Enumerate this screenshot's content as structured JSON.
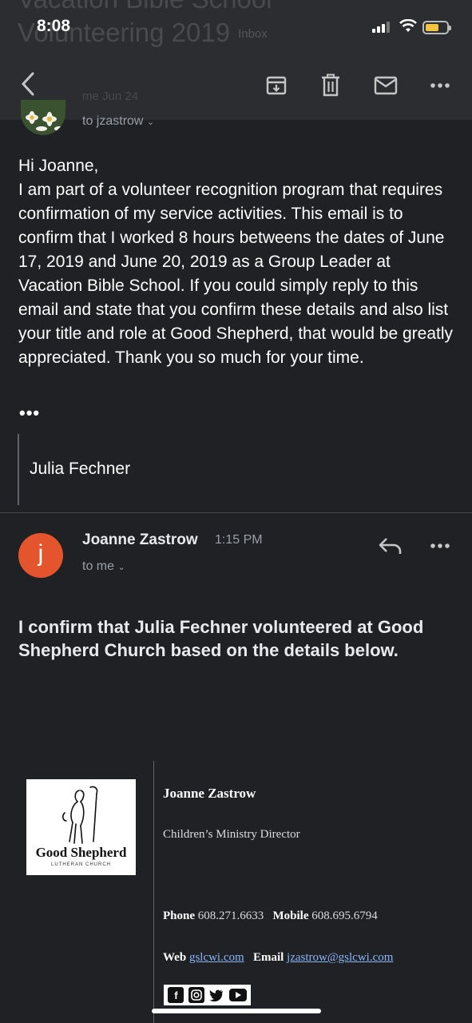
{
  "status_bar": {
    "time": "8:08"
  },
  "header": {
    "ghost_subject_line1": "Vacation Bible School",
    "ghost_subject_line2": "Volunteering 2019",
    "ghost_label": "Inbox",
    "ghost_sender": "me  Jun 24"
  },
  "first_message": {
    "to_line": "to jzastrow",
    "body": "Hi Joanne,\nI am part of a volunteer recognition program that requires confirmation of my service activities. This email is to confirm that I worked 8 hours betweens the dates of June 17, 2019 and June 20, 2019 as a Group Leader at Vacation Bible School. If you could simply reply to this email and state that you confirm these details and also list your title and role at Good Shepherd, that would be greatly appreciated. Thank you so much for your time.",
    "ellipsis": "•••",
    "quoted_name": "Julia Fechner"
  },
  "reply_message": {
    "avatar_letter": "j",
    "sender": "Joanne Zastrow",
    "time": "1:15 PM",
    "to_line": "to me",
    "body": "I confirm that Julia Fechner volunteered at Good Shepherd Church based on the details below."
  },
  "signature": {
    "logo_text": "Good Shepherd",
    "logo_sub": "LUTHERAN CHURCH",
    "name": "Joanne Zastrow",
    "title": "Children’s Ministry Director",
    "phone_label": "Phone",
    "phone": "608.271.6633",
    "mobile_label": "Mobile",
    "mobile": "608.695.6794",
    "web_label": "Web",
    "web": "gslcwi.com",
    "email_label": "Email",
    "email": "jzastrow@gslcwi.com",
    "social_icons": [
      "facebook-icon",
      "instagram-icon",
      "twitter-icon",
      "youtube-icon"
    ]
  },
  "colors": {
    "avatar": "#e5552d",
    "link": "#8ab4f8",
    "battery": "#f4c43c"
  }
}
